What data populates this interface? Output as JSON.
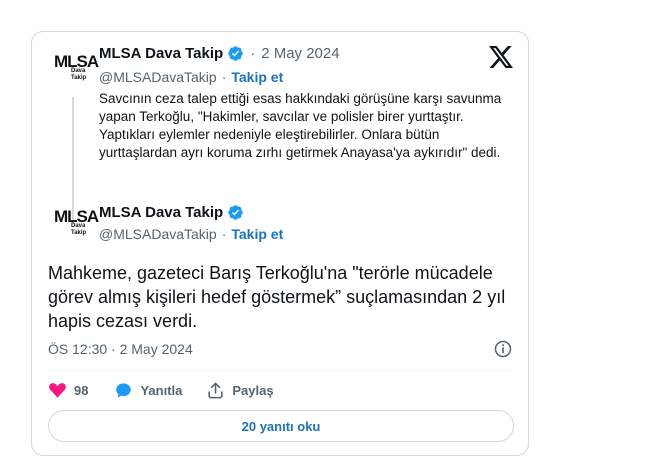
{
  "quoted_tweet": {
    "author_name": "MLSA Dava Takip",
    "separator": "·",
    "date": "2 May 2024",
    "handle": "@MLSADavaTakip",
    "follow_separator": "·",
    "follow_label": "Takip et",
    "text": "Savcının ceza talep ettiği esas hakkındaki görüşüne karşı savunma yapan Terkoğlu, \"Hakimler, savcılar ve polisler birer yurttaştır. Yaptıkları eylemler nedeniyle eleştirebilirler. Onlara bütün yurttaşlardan ayrı koruma zırhı getirmek Anayasa'ya aykırıdır\" dedi."
  },
  "main_tweet": {
    "author_name": "MLSA Dava Takip",
    "handle": "@MLSADavaTakip",
    "follow_separator": "·",
    "follow_label": "Takip et",
    "text": "Mahkeme, gazeteci Barış Terkoğlu'na \"terörle mücadele görev almış kişileri hedef göstermek” suçlamasından 2 yıl hapis cezası verdi.",
    "timestamp": "ÖS 12:30 · 2 May 2024"
  },
  "logo": {
    "main": "MLSA",
    "sub1": "Dava",
    "sub2": "Takip"
  },
  "actions": {
    "like_count": "98",
    "reply_label": "Yanıtla",
    "share_label": "Paylaş"
  },
  "read_replies_label": "20 yanıtı oku",
  "colors": {
    "accent": "#1d9bf0",
    "link": "#1d72b8",
    "like": "#f91880",
    "muted": "#536471"
  },
  "icons": [
    "x-logo-icon",
    "verified-badge-icon",
    "info-icon",
    "heart-icon",
    "reply-icon",
    "share-icon"
  ]
}
